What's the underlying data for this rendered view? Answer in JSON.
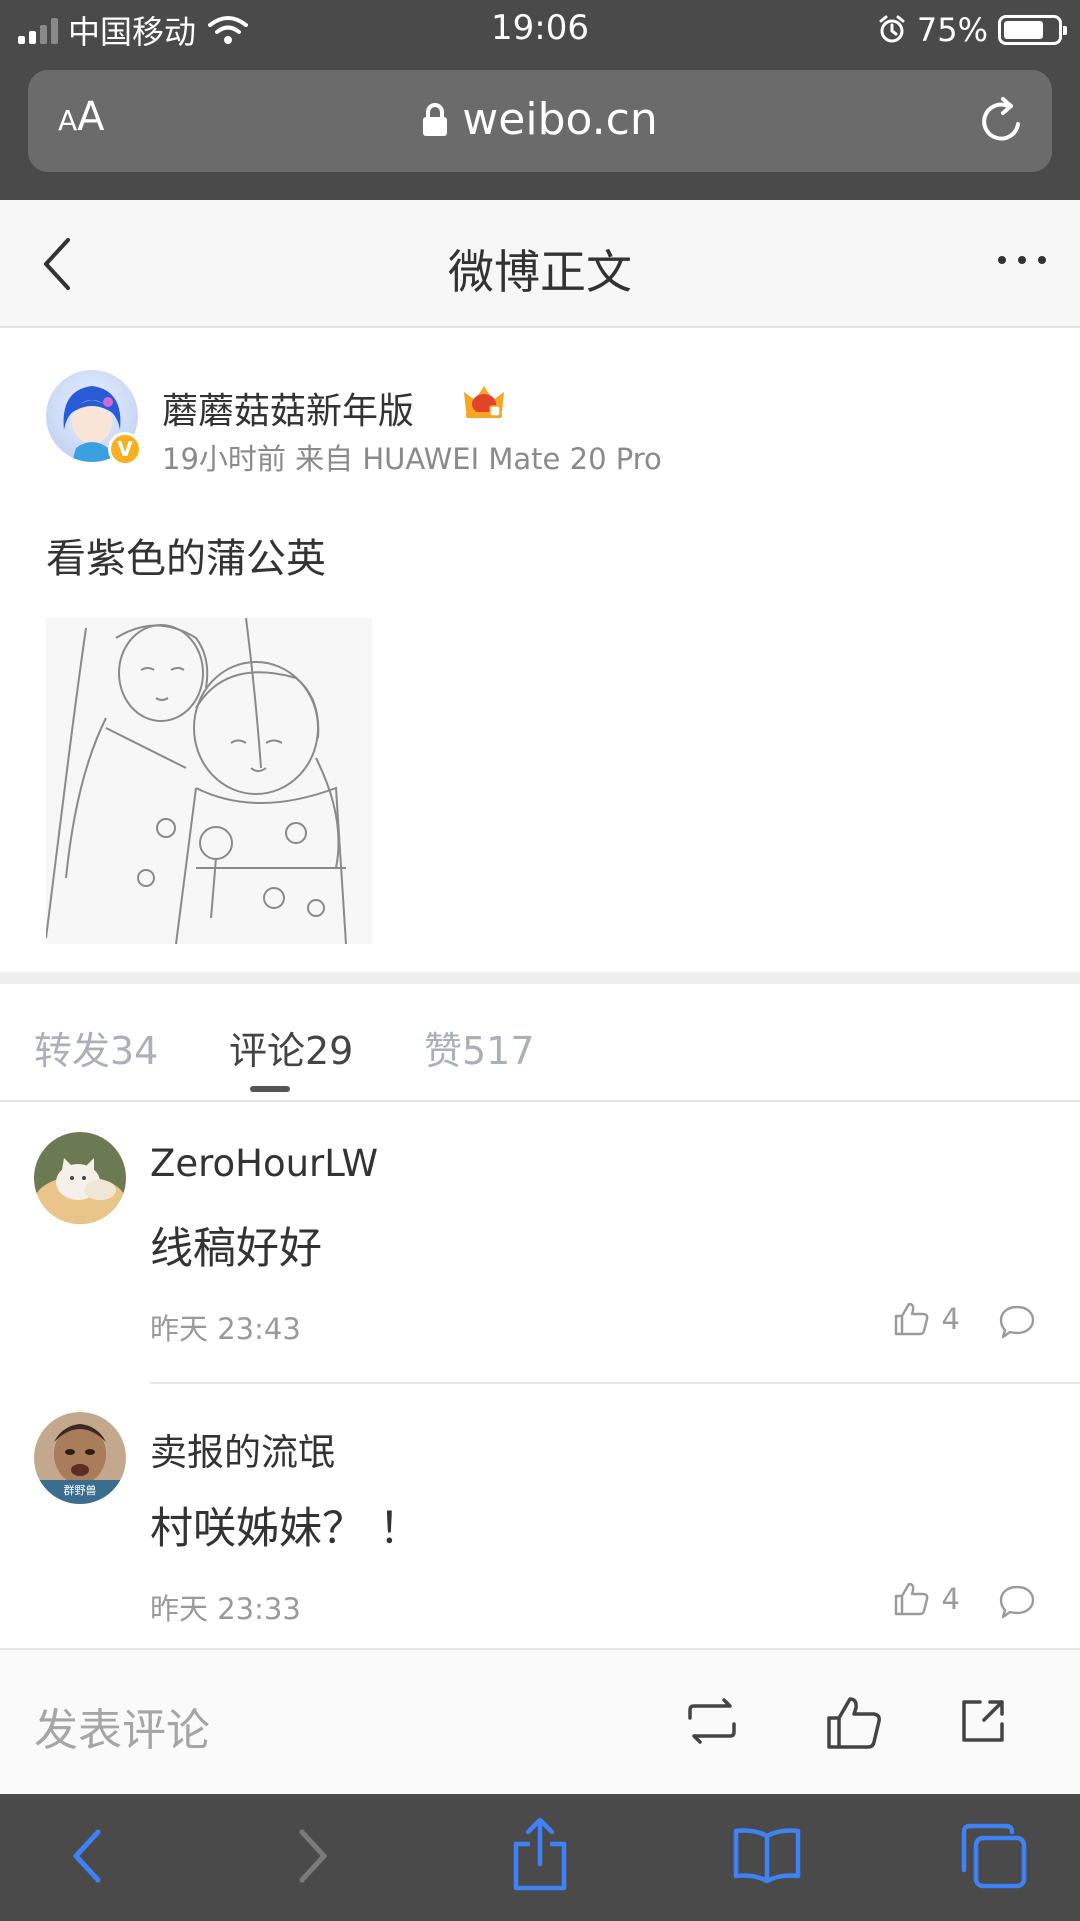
{
  "status_bar": {
    "carrier": "中国移动",
    "time": "19:06",
    "battery_percent": "75%",
    "battery_level": 0.75,
    "icons": [
      "signal-icon",
      "wifi-icon",
      "alarm-icon",
      "battery-icon"
    ]
  },
  "browser": {
    "text_size_label_small": "A",
    "text_size_label_large": "A",
    "url": "weibo.cn",
    "icons": [
      "lock-icon",
      "reload-icon"
    ]
  },
  "page_header": {
    "title": "微博正文",
    "icons": [
      "back-chevron-icon",
      "more-icon"
    ]
  },
  "post": {
    "author": "蘑蘑菇菇新年版",
    "verified_badge": "V",
    "meta": "19小时前 来自 HUAWEI Mate 20 Pro",
    "text": "看紫色的蒲公英",
    "image_alt": "sketch-illustration"
  },
  "tabs": [
    {
      "label": "转发34",
      "active": false
    },
    {
      "label": "评论29",
      "active": true
    },
    {
      "label": "赞517",
      "active": false
    }
  ],
  "comments": [
    {
      "name": "ZeroHourLW",
      "text": "线稿好好",
      "time": "昨天 23:43",
      "likes": "4"
    },
    {
      "name": "卖报的流氓",
      "text": "村咲姊妹？ ！",
      "time": "昨天 23:33",
      "likes": "4"
    }
  ],
  "comment_avatar2_text": "群野兽",
  "action_bar": {
    "placeholder": "发表评论",
    "icons": [
      "repost-icon",
      "like-icon",
      "share-icon"
    ]
  },
  "safari_toolbar": {
    "icons": [
      "back-arrow-icon",
      "forward-arrow-icon",
      "share-up-icon",
      "bookmarks-icon",
      "tabs-icon"
    ]
  },
  "colors": {
    "chrome_dark": "#4a4a4a",
    "url_field": "#6b6b6b",
    "safari_blue": "#3d82f6",
    "muted_text": "#9a9a9a",
    "verified_gold": "#f7b022"
  }
}
